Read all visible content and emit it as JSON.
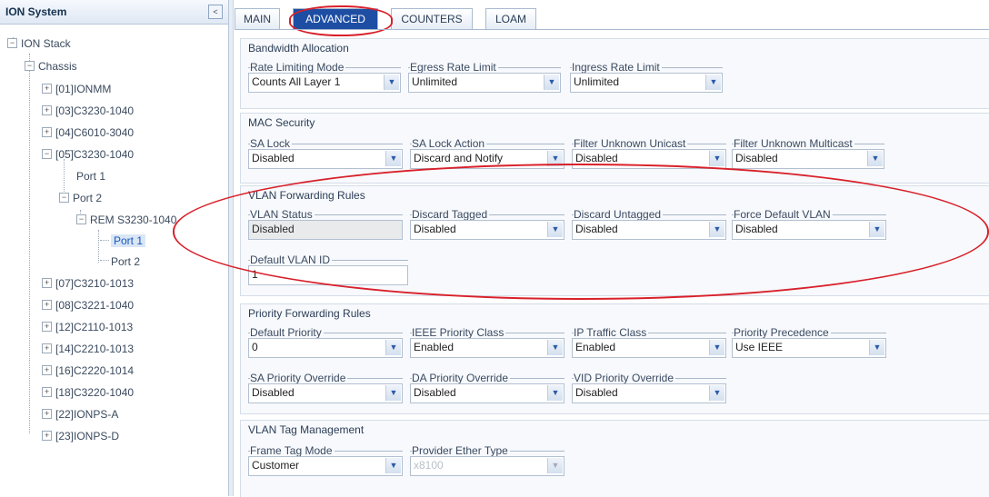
{
  "left_panel": {
    "title": "ION System",
    "collapse_glyph": "<",
    "tree": [
      {
        "label": "ION Stack",
        "expander": "−"
      },
      {
        "label": "Chassis",
        "expander": "−"
      },
      {
        "label": "[01]IONMM",
        "expander": "+"
      },
      {
        "label": "[03]C3230-1040",
        "expander": "+"
      },
      {
        "label": "[04]C6010-3040",
        "expander": "+"
      },
      {
        "label": "[05]C3230-1040",
        "expander": "−"
      },
      {
        "label": "Port 1",
        "expander": ""
      },
      {
        "label": "Port 2",
        "expander": "−"
      },
      {
        "label": "REM S3230-1040",
        "expander": "−"
      },
      {
        "label": "Port 1",
        "expander": ""
      },
      {
        "label": "Port 2",
        "expander": ""
      },
      {
        "label": "[07]C3210-1013",
        "expander": "+"
      },
      {
        "label": "[08]C3221-1040",
        "expander": "+"
      },
      {
        "label": "[12]C2110-1013",
        "expander": "+"
      },
      {
        "label": "[14]C2210-1013",
        "expander": "+"
      },
      {
        "label": "[16]C2220-1014",
        "expander": "+"
      },
      {
        "label": "[18]C3220-1040",
        "expander": "+"
      },
      {
        "label": "[22]IONPS-A",
        "expander": "+"
      },
      {
        "label": "[23]IONPS-D",
        "expander": "+"
      }
    ]
  },
  "tabs": [
    {
      "label": "MAIN"
    },
    {
      "label": "ADVANCED"
    },
    {
      "label": "COUNTERS"
    },
    {
      "label": "LOAM"
    }
  ],
  "active_tab": "ADVANCED",
  "sections": {
    "bandwidth": {
      "title": "Bandwidth Allocation",
      "rate_limiting_mode": {
        "label": "Rate Limiting Mode",
        "value": "Counts All Layer 1"
      },
      "egress_rate_limit": {
        "label": "Egress Rate Limit",
        "value": "Unlimited"
      },
      "ingress_rate_limit": {
        "label": "Ingress Rate Limit",
        "value": "Unlimited"
      }
    },
    "mac_security": {
      "title": "MAC Security",
      "sa_lock": {
        "label": "SA Lock",
        "value": "Disabled"
      },
      "sa_lock_action": {
        "label": "SA Lock Action",
        "value": "Discard and Notify"
      },
      "filter_unknown_unicast": {
        "label": "Filter Unknown Unicast",
        "value": "Disabled"
      },
      "filter_unknown_multicast": {
        "label": "Filter Unknown Multicast",
        "value": "Disabled"
      }
    },
    "vlan_forwarding": {
      "title": "VLAN Forwarding Rules",
      "vlan_status": {
        "label": "VLAN Status",
        "value": "Disabled"
      },
      "discard_tagged": {
        "label": "Discard Tagged",
        "value": "Disabled"
      },
      "discard_untagged": {
        "label": "Discard Untagged",
        "value": "Disabled"
      },
      "force_default_vlan": {
        "label": "Force Default VLAN",
        "value": "Disabled"
      },
      "default_vlan_id": {
        "label": "Default VLAN ID",
        "value": "1"
      }
    },
    "priority_forwarding": {
      "title": "Priority Forwarding Rules",
      "default_priority": {
        "label": "Default Priority",
        "value": "0"
      },
      "ieee_priority_class": {
        "label": "IEEE Priority Class",
        "value": "Enabled"
      },
      "ip_traffic_class": {
        "label": "IP Traffic Class",
        "value": "Enabled"
      },
      "priority_precedence": {
        "label": "Priority Precedence",
        "value": "Use IEEE"
      },
      "sa_priority_override": {
        "label": "SA Priority Override",
        "value": "Disabled"
      },
      "da_priority_override": {
        "label": "DA Priority Override",
        "value": "Disabled"
      },
      "vid_priority_override": {
        "label": "VID Priority Override",
        "value": "Disabled"
      }
    },
    "vlan_tag": {
      "title": "VLAN Tag Management",
      "frame_tag_mode": {
        "label": "Frame Tag Mode",
        "value": "Customer"
      },
      "provider_ether_type": {
        "label": "Provider Ether Type",
        "value": "x8100"
      }
    }
  },
  "colors": {
    "accent_tab": "#1e4ea3",
    "annotation_ring": "#d8202a"
  },
  "icons": {
    "dropdown": "chevron-down-icon",
    "spinner": "spinner-icon"
  }
}
